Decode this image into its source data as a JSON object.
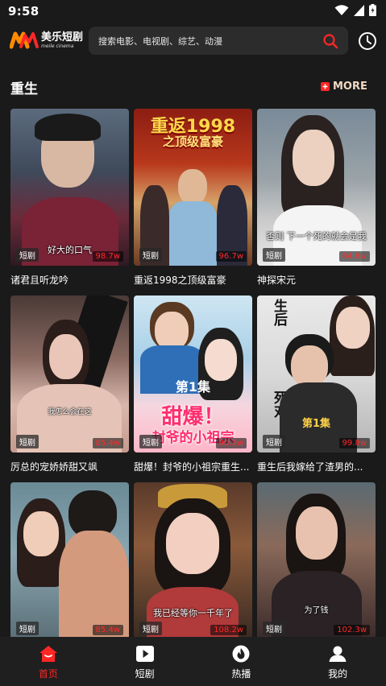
{
  "status_bar": {
    "time": "9:58"
  },
  "app": {
    "name": "美乐短剧",
    "name_en": "meile cinema",
    "brand_color": "#ff2626"
  },
  "search": {
    "placeholder": "搜索电影、电视剧、综艺、动漫"
  },
  "section": {
    "title": "重生",
    "more_label": "MORE"
  },
  "cards": [
    {
      "title": "诸君且听龙吟",
      "badge": "短剧",
      "views": "98.7w",
      "subtitle": "好大的口气"
    },
    {
      "title": "重返1998之顶级富豪",
      "badge": "短剧",
      "views": "96.7w",
      "poster_text": "重返1998",
      "poster_text2": "之顶级富豪"
    },
    {
      "title": "神探宋元",
      "badge": "短剧",
      "views": "84.6w",
      "subtitle": "否则 下一个死的就会是我"
    },
    {
      "title": "厉总的宠娇娇甜又飒",
      "badge": "短剧",
      "views": "85.4w",
      "subtitle": "我怎么会在这"
    },
    {
      "title": "甜爆！封爷的小祖宗重生...",
      "badge": "短剧",
      "views": "90.3w",
      "poster_text": "甜爆！",
      "poster_text2": "封爷的小祖宗",
      "episode": "第1集"
    },
    {
      "title": "重生后我嫁给了渣男的...",
      "badge": "短剧",
      "views": "99.8w",
      "episode": "第1集",
      "vertical_text": "生后",
      "vertical_text2": "死对"
    },
    {
      "title": "",
      "badge": "短剧",
      "views": "85.4w"
    },
    {
      "title": "",
      "badge": "短剧",
      "views": "108.2w",
      "subtitle": "我已经等你一千年了"
    },
    {
      "title": "",
      "badge": "短剧",
      "views": "102.3w",
      "subtitle": "为了钱"
    }
  ],
  "nav": [
    {
      "label": "首页",
      "icon": "home-icon",
      "active": true
    },
    {
      "label": "短剧",
      "icon": "play-icon",
      "active": false
    },
    {
      "label": "热播",
      "icon": "flame-icon",
      "active": false
    },
    {
      "label": "我的",
      "icon": "user-icon",
      "active": false
    }
  ]
}
